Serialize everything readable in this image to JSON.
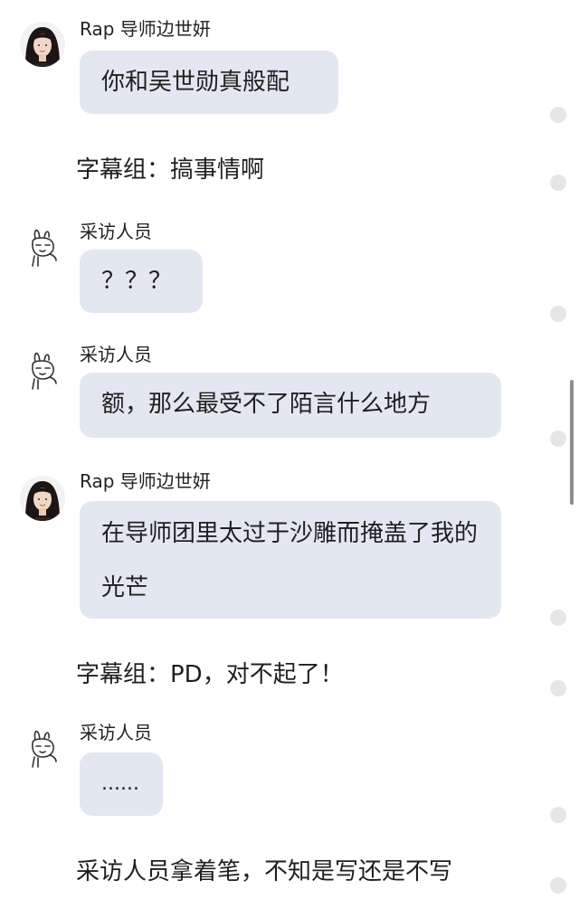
{
  "messages": [
    {
      "kind": "chat",
      "avatar": "woman-avatar-photo",
      "sender": "Rap 导师边世妍",
      "text": "你和吴世勋真般配"
    },
    {
      "kind": "narration",
      "text": "字幕组：搞事情啊"
    },
    {
      "kind": "chat",
      "avatar": "bunny-doodle-avatar",
      "sender": "采访人员",
      "text": "？？？"
    },
    {
      "kind": "chat",
      "avatar": "bunny-doodle-avatar",
      "sender": "采访人员",
      "text": "额，那么最受不了陌言什么地方"
    },
    {
      "kind": "chat",
      "avatar": "woman-avatar-photo",
      "sender": "Rap 导师边世妍",
      "text": "在导师团里太过于沙雕而掩盖了我的光芒"
    },
    {
      "kind": "narration",
      "text": "字幕组：PD，对不起了！"
    },
    {
      "kind": "chat",
      "avatar": "bunny-doodle-avatar",
      "sender": "采访人员",
      "text": "......"
    },
    {
      "kind": "narration",
      "text": "采访人员拿着笔，不知是写还是不写"
    }
  ],
  "colors": {
    "bubble": "#e3e7f1",
    "background": "#ffffff",
    "text": "#1f1f1f",
    "scrollbar": "#8e8e8e",
    "side_dot": "#e6e6e6"
  }
}
